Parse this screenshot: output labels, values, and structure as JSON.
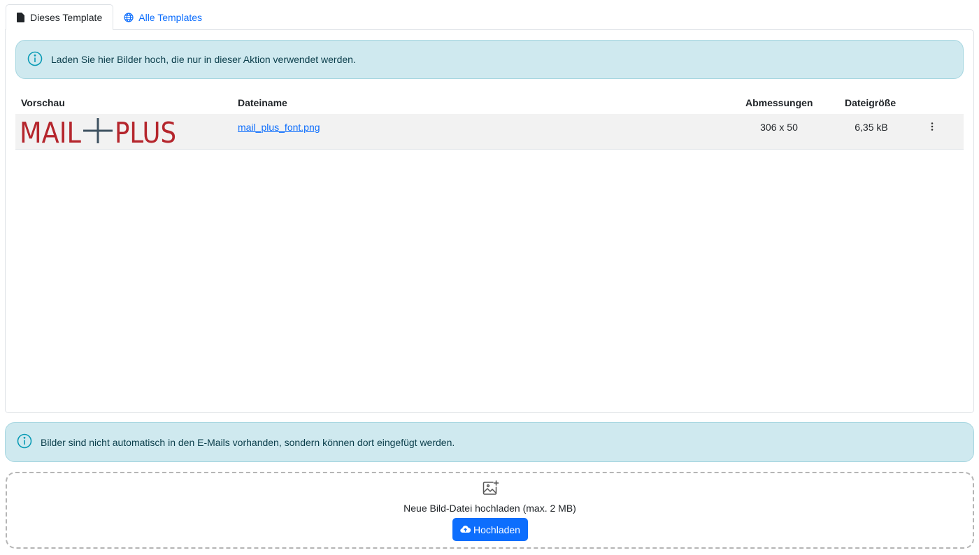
{
  "tabs": [
    {
      "label": "Dieses Template",
      "icon": "file-icon",
      "active": true
    },
    {
      "label": "Alle Templates",
      "icon": "globe-icon",
      "active": false
    }
  ],
  "info_top": {
    "text": "Laden Sie hier Bilder hoch, die nur in dieser Aktion verwendet werden.",
    "icon": "info-circle-icon"
  },
  "table": {
    "headers": {
      "preview": "Vorschau",
      "name": "Dateiname",
      "dimensions": "Abmessungen",
      "size": "Dateigröße"
    },
    "rows": [
      {
        "preview_text": "MAIL+PLUS",
        "filename": "mail_plus_font.png",
        "dimensions": "306 x 50",
        "size": "6,35 kB",
        "menu_icon": "kebab-icon"
      }
    ]
  },
  "info_bottom": {
    "text": "Bilder sind nicht automatisch in den E-Mails vorhanden, sondern können dort eingefügt werden.",
    "icon": "info-circle-icon"
  },
  "upload": {
    "label": "Neue Bild-Datei hochladen (max. 2 MB)",
    "button": "Hochladen",
    "icon": "image-add-icon",
    "button_icon": "cloud-upload-icon"
  },
  "colors": {
    "accent": "#0d6efd",
    "info_bg": "#cfe9ef",
    "info_border": "#a6d6e0",
    "logo_red": "#b5262d",
    "logo_cross": "#3d5160"
  }
}
